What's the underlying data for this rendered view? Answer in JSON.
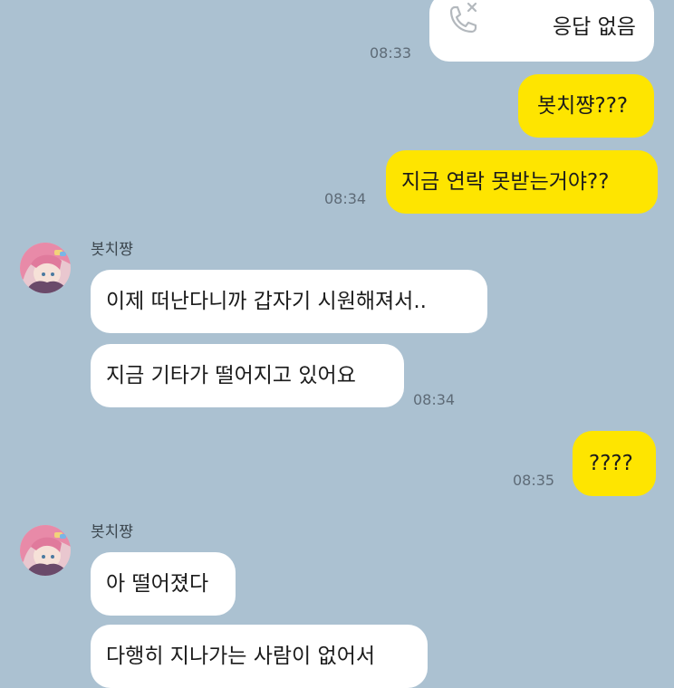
{
  "messages": {
    "call": {
      "text": "응답 없음",
      "time": "08:33"
    },
    "me1": {
      "text": "봇치쨩???"
    },
    "me2": {
      "text": "지금 연락 못받는거야??",
      "time": "08:34"
    },
    "group1": {
      "sender": "봇치쨩",
      "msg1": "이제 떠난다니까 갑자기 시원해져서..",
      "msg2": "지금 기타가 떨어지고 있어요",
      "time": "08:34"
    },
    "me3": {
      "text": "????",
      "time": "08:35"
    },
    "group2": {
      "sender": "봇치쨩",
      "msg1": "아 떨어졌다",
      "msg2": "다행히 지나가는 사람이 없어서"
    }
  },
  "icons": {
    "missed_call": "missed-call-icon",
    "avatar": "avatar-pink-hair"
  },
  "colors": {
    "background": "#abc1d1",
    "my_bubble": "#fee500",
    "other_bubble": "#ffffff"
  }
}
